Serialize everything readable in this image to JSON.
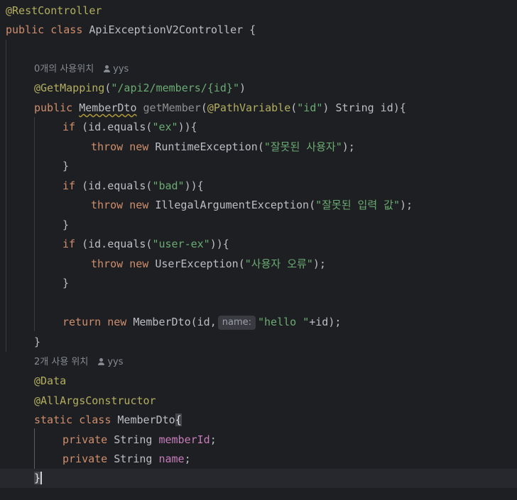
{
  "annotations": {
    "rest_controller": "@RestController",
    "get_mapping": "@GetMapping",
    "path_variable": "@PathVariable",
    "data": "@Data",
    "all_args_constructor": "@AllArgsConstructor"
  },
  "keywords": {
    "public": "public",
    "class": "class",
    "if": "if",
    "throw": "throw",
    "new": "new",
    "return": "return",
    "static": "static",
    "private": "private"
  },
  "types": {
    "controller": "ApiExceptionV2Controller",
    "member_dto": "MemberDto",
    "string": "String",
    "runtime_exception": "RuntimeException",
    "illegal_argument_exception": "IllegalArgumentException",
    "user_exception": "UserException"
  },
  "method": {
    "name": "getMember"
  },
  "strings": {
    "mapping_path": "\"/api2/members/{id}\"",
    "id": "\"id\"",
    "ex": "\"ex\"",
    "bad": "\"bad\"",
    "user_ex": "\"user-ex\"",
    "wrong_user": "\"잘못된 사용자\"",
    "wrong_input": "\"잘못된 입력 값\"",
    "user_error": "\"사용자 오류\"",
    "hello": "\"hello \""
  },
  "fields": {
    "member_id": "memberId",
    "name": "name"
  },
  "inlay": {
    "name_param": "name:"
  },
  "hints": {
    "method_usages": "0개의 사용위치",
    "class_usages": "2개 사용 위치",
    "author": "yys"
  },
  "colors": {
    "background": "#1e1f22",
    "annotation": "#b3ae60",
    "keyword": "#cf8e6d",
    "string": "#6aab73",
    "field": "#c77dbb",
    "default_text": "#bcbec4"
  }
}
